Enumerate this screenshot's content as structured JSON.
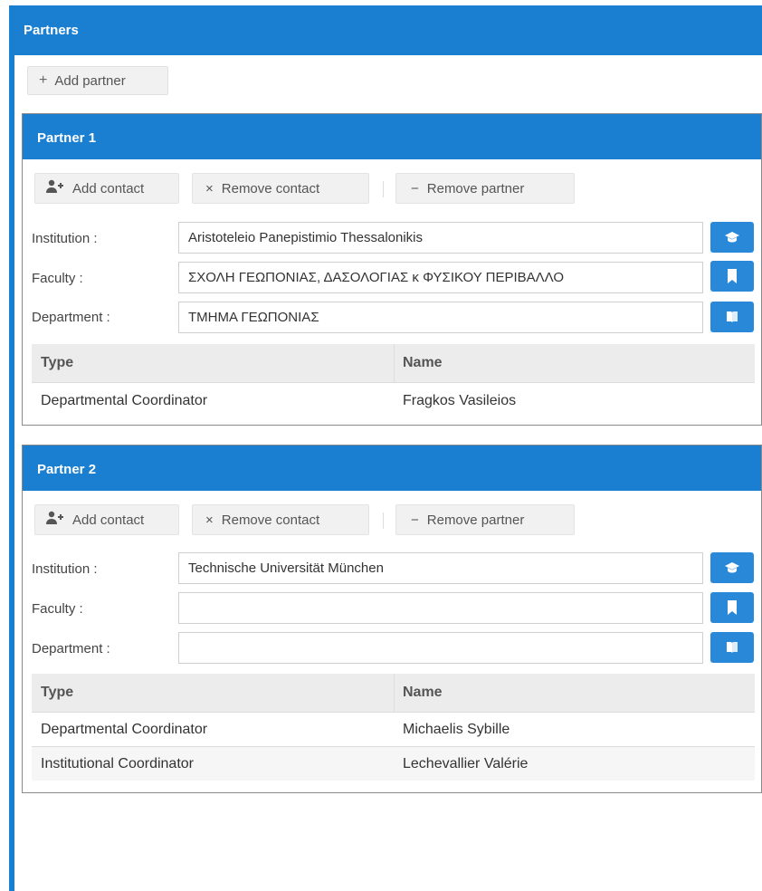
{
  "header": {
    "title": "Partners"
  },
  "toolbar": {
    "add_partner_label": "Add partner",
    "add_partner_icon": "plus-icon"
  },
  "colors": {
    "accent": "#1b7fd1",
    "button_bg": "#f1f1f1",
    "side_button": "#2a88d8"
  },
  "partners": [
    {
      "title": "Partner 1",
      "buttons": {
        "add_contact": "Add contact",
        "remove_contact": "Remove contact",
        "remove_partner": "Remove partner"
      },
      "fields": {
        "institution_label": "Institution :",
        "institution_value": "Aristoteleio Panepistimio Thessalonikis",
        "faculty_label": "Faculty :",
        "faculty_value": "ΣΧΟΛΗ ΓΕΩΠΟΝΙΑΣ, ΔΑΣΟΛΟΓΙΑΣ κ ΦΥΣΙΚΟΥ ΠΕΡΙΒΑΛΛΟ",
        "department_label": "Department :",
        "department_value": "ΤΜΗΜΑ ΓΕΩΠΟΝΙΑΣ"
      },
      "table": {
        "headers": [
          "Type",
          "Name"
        ],
        "rows": [
          [
            "Departmental Coordinator",
            "Fragkos Vasileios"
          ]
        ]
      }
    },
    {
      "title": "Partner 2",
      "buttons": {
        "add_contact": "Add contact",
        "remove_contact": "Remove contact",
        "remove_partner": "Remove partner"
      },
      "fields": {
        "institution_label": "Institution :",
        "institution_value": "Technische Universität München",
        "faculty_label": "Faculty :",
        "faculty_value": "",
        "department_label": "Department :",
        "department_value": ""
      },
      "table": {
        "headers": [
          "Type",
          "Name"
        ],
        "rows": [
          [
            "Departmental Coordinator",
            "Michaelis Sybille"
          ],
          [
            "Institutional Coordinator",
            "Lechevallier Valérie"
          ]
        ]
      }
    }
  ]
}
